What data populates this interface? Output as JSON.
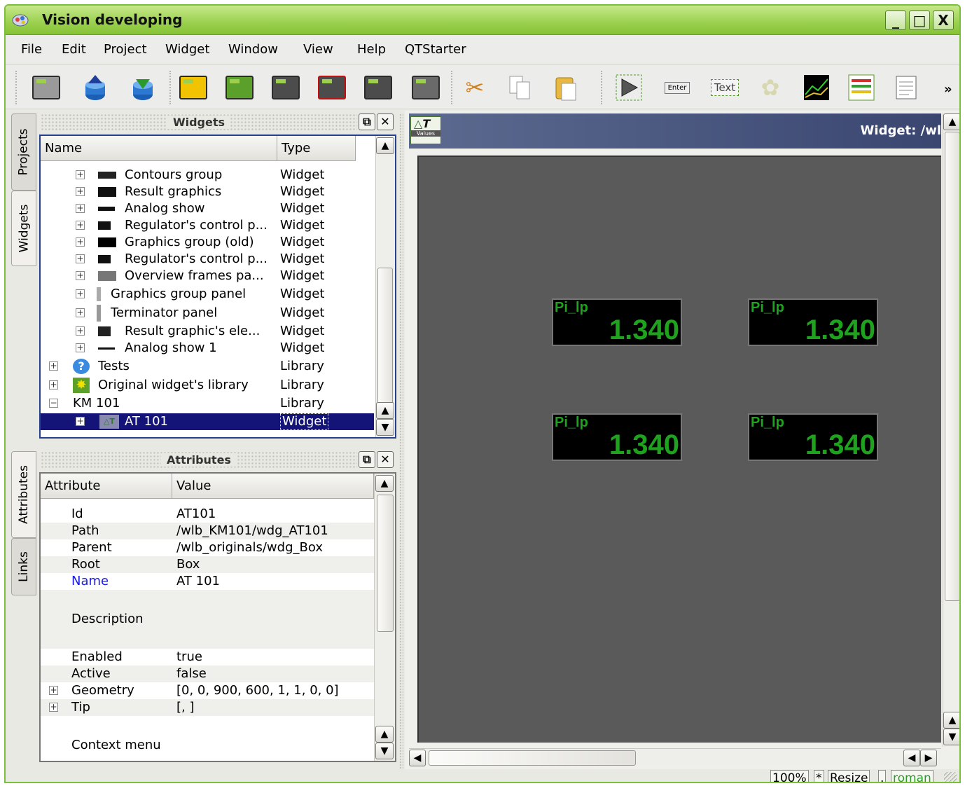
{
  "window": {
    "title": "Vision developing",
    "controls": [
      "_",
      "□",
      "X"
    ]
  },
  "menu": [
    "File",
    "Edit",
    "Project",
    "Widget",
    "Window",
    "View",
    "Help",
    "QTStarter"
  ],
  "toolbar": {
    "overflow": "»",
    "enter_label": "Enter",
    "text_label": "Text"
  },
  "side_tabs_top": [
    "Projects",
    "Widgets"
  ],
  "side_tabs_bottom": [
    "Attributes",
    "Links"
  ],
  "widgets_panel": {
    "title": "Widgets",
    "columns": [
      "Name",
      "Type"
    ],
    "rows": [
      {
        "name": "Contours group",
        "type": "Widget"
      },
      {
        "name": "Result graphics",
        "type": "Widget"
      },
      {
        "name": "Analog show",
        "type": "Widget"
      },
      {
        "name": "Regulator's control p...",
        "type": "Widget"
      },
      {
        "name": "Graphics group (old)",
        "type": "Widget"
      },
      {
        "name": "Regulator's control p...",
        "type": "Widget"
      },
      {
        "name": "Overview frames pa...",
        "type": "Widget"
      },
      {
        "name": "Graphics group panel",
        "type": "Widget"
      },
      {
        "name": "Terminator panel",
        "type": "Widget"
      },
      {
        "name": "Result graphic's ele...",
        "type": "Widget"
      },
      {
        "name": "Analog show 1",
        "type": "Widget"
      },
      {
        "name": "Tests",
        "type": "Library"
      },
      {
        "name": "Original widget's library",
        "type": "Library"
      },
      {
        "name": "KM 101",
        "type": "Library"
      },
      {
        "name": "AT 101",
        "type": "Widget"
      }
    ]
  },
  "attributes_panel": {
    "title": "Attributes",
    "columns": [
      "Attribute",
      "Value"
    ],
    "rows": [
      {
        "attr": "Id",
        "value": "AT101"
      },
      {
        "attr": "Path",
        "value": "/wlb_KM101/wdg_AT101"
      },
      {
        "attr": "Parent",
        "value": "/wlb_originals/wdg_Box"
      },
      {
        "attr": "Root",
        "value": "Box"
      },
      {
        "attr": "Name",
        "value": "AT 101"
      },
      {
        "attr": "Description",
        "value": ""
      },
      {
        "attr": "Enabled",
        "value": "true"
      },
      {
        "attr": "Active",
        "value": "false"
      },
      {
        "attr": "Geometry",
        "value": "[0, 0, 900, 600, 1, 1, 0, 0]"
      },
      {
        "attr": "Tip",
        "value": "[, ]"
      },
      {
        "attr": "Context menu",
        "value": ""
      }
    ]
  },
  "workarea": {
    "title": "Widget: /wl",
    "icon_label": "Values",
    "gauges": [
      {
        "label": "Pi_lp",
        "value": "1.340"
      },
      {
        "label": "Pi_lp",
        "value": "1.340"
      },
      {
        "label": "Pi_lp",
        "value": "1.340"
      },
      {
        "label": "Pi_lp",
        "value": "1.340"
      }
    ]
  },
  "statusbar": {
    "zoom": "100%",
    "modified": "*",
    "mode": "Resize",
    "dot": ".",
    "user": "roman"
  },
  "colors": {
    "titlebar": "#9ad04e",
    "selection": "#141478",
    "gauge_text": "#1fa31f",
    "canvas": "#5a5a5a"
  }
}
